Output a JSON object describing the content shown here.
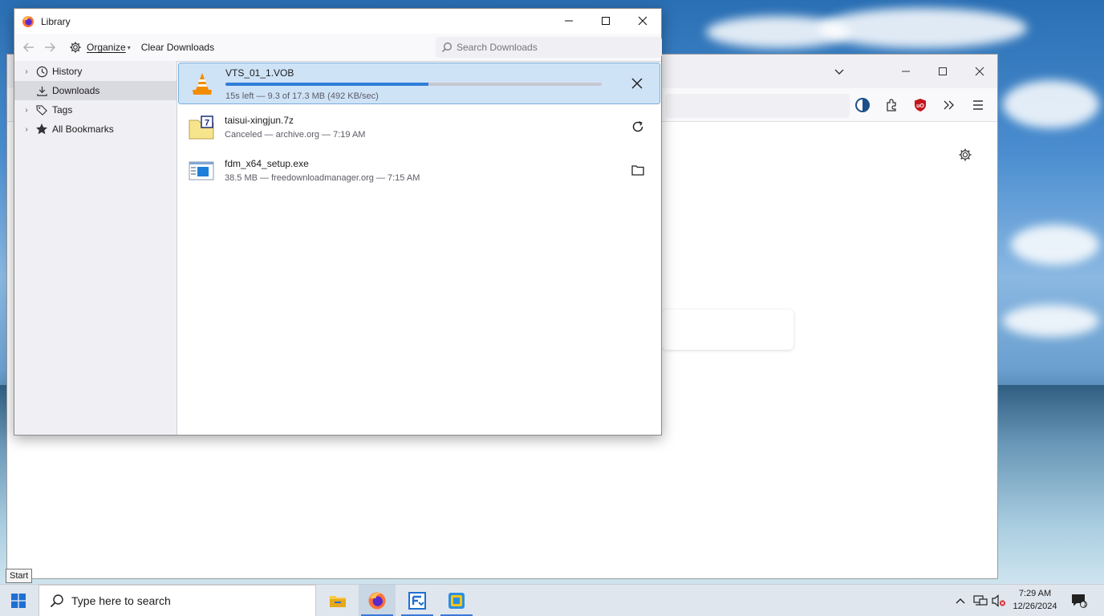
{
  "library": {
    "title": "Library",
    "toolbar": {
      "back_icon": "arrow-left-icon",
      "forward_icon": "arrow-right-icon",
      "organize_label": "Organize",
      "clear_label": "Clear Downloads",
      "search_placeholder": "Search Downloads"
    },
    "sidebar": {
      "items": [
        {
          "label": "History",
          "icon": "clock-icon"
        },
        {
          "label": "Downloads",
          "icon": "download-icon"
        },
        {
          "label": "Tags",
          "icon": "tag-icon"
        },
        {
          "label": "All Bookmarks",
          "icon": "star-icon"
        }
      ]
    },
    "downloads": [
      {
        "name": "VTS_01_1.VOB",
        "status": "15s left — 9.3 of 17.3 MB (492 KB/sec)",
        "progress": 0.54,
        "action": "cancel-icon",
        "file_icon": "vlc-cone-icon"
      },
      {
        "name": "taisui-xingjun.7z",
        "status": "Canceled — archive.org — 7:19 AM",
        "action": "retry-icon",
        "file_icon": "7z-archive-icon"
      },
      {
        "name": "fdm_x64_setup.exe",
        "status": "38.5 MB — freedownloadmanager.org — 7:15 AM",
        "action": "folder-icon",
        "file_icon": "exe-window-icon"
      }
    ]
  },
  "taskbar": {
    "search_placeholder": "Type here to search",
    "start_tooltip": "Start",
    "time": "7:29 AM",
    "date": "12/26/2024",
    "notification_count": "1"
  },
  "colors": {
    "accent": "#2f7fd8",
    "selected_row": "#cfe3f7",
    "ublock_red": "#c4161c"
  }
}
